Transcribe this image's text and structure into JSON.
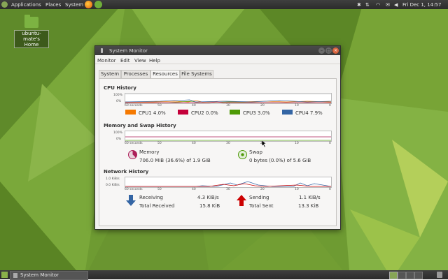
{
  "top_panel": {
    "menus": [
      "Applications",
      "Places",
      "System"
    ],
    "clock": "Fri Dec 1, 14:57"
  },
  "desktop": {
    "icon_label": "ubuntu-mate's Home"
  },
  "window": {
    "title": "System Monitor",
    "menu": [
      "Monitor",
      "Edit",
      "View",
      "Help"
    ],
    "tabs": [
      "System",
      "Processes",
      "Resources",
      "File Systems"
    ],
    "active_tab": "Resources",
    "cpu": {
      "title": "CPU History",
      "y_labels": [
        "100%",
        "0%"
      ],
      "x_labels": [
        "60 seconds",
        "50",
        "40",
        "30",
        "20",
        "10",
        "0"
      ],
      "legend": [
        {
          "name": "CPU1",
          "value": "4.0%",
          "color": "#f57900"
        },
        {
          "name": "CPU2",
          "value": "0.0%",
          "color": "#c4003a"
        },
        {
          "name": "CPU3",
          "value": "3.0%",
          "color": "#4e9a06"
        },
        {
          "name": "CPU4",
          "value": "7.9%",
          "color": "#3465a4"
        }
      ]
    },
    "memory": {
      "title": "Memory and Swap History",
      "y_labels": [
        "100%",
        "0%"
      ],
      "x_labels": [
        "60 seconds",
        "50",
        "40",
        "30",
        "20",
        "10",
        "0"
      ],
      "memory_label": "Memory",
      "memory_value": "706.0 MiB (36.6%) of 1.9 GiB",
      "memory_fraction": 0.366,
      "swap_label": "Swap",
      "swap_value": "0 bytes (0.0%) of 5.6 GiB",
      "swap_fraction": 0.0
    },
    "network": {
      "title": "Network History",
      "y_labels": [
        "1.0 KiB/s",
        "0.0 KiB/s"
      ],
      "x_labels": [
        "60 seconds",
        "50",
        "40",
        "30",
        "20",
        "10",
        "0"
      ],
      "receiving_label": "Receiving",
      "receiving_value": "4.3 KiB/s",
      "total_received_label": "Total Received",
      "total_received_value": "15.8 KiB",
      "sending_label": "Sending",
      "sending_value": "1.1 KiB/s",
      "total_sent_label": "Total Sent",
      "total_sent_value": "13.3 KiB"
    }
  },
  "bottom_panel": {
    "task": "System Monitor"
  },
  "colors": {
    "desktop_green": "#6e9b32",
    "panel": "#333333",
    "memory_color": "#ad1f59",
    "swap_color": "#4e9a06",
    "receiving_color": "#3465a4",
    "sending_color": "#cc0000"
  }
}
